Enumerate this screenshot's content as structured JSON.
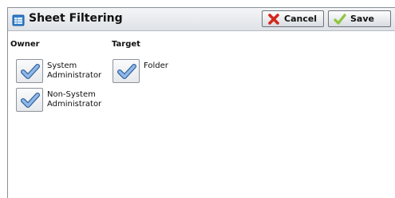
{
  "header": {
    "title": "Sheet Filtering",
    "cancel_label": "Cancel",
    "save_label": "Save"
  },
  "owner": {
    "label": "Owner",
    "options": [
      {
        "line1": "System",
        "line2": "Administrator",
        "checked": true
      },
      {
        "line1": "Non-System",
        "line2": "Administrator",
        "checked": true
      }
    ]
  },
  "target": {
    "label": "Target",
    "options": [
      {
        "line1": "Folder",
        "checked": true
      }
    ]
  },
  "colors": {
    "check_blue": "#4a83c7",
    "cancel_red": "#d4261b",
    "save_green": "#8dc63f"
  }
}
